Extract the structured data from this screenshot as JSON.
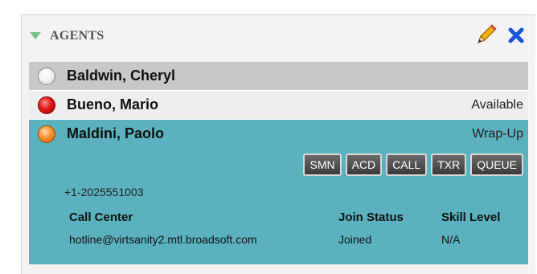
{
  "panel": {
    "title": "AGENTS",
    "icons": {
      "collapse": "triangle-down-icon",
      "edit": "pencil-icon",
      "close": "close-x-icon"
    }
  },
  "agents": [
    {
      "name": "Baldwin, Cheryl",
      "status": "",
      "indicator": "unavailable-white"
    },
    {
      "name": "Bueno, Mario",
      "status": "Available",
      "indicator": "busy-red"
    },
    {
      "name": "Maldini, Paolo",
      "status": "Wrap-Up",
      "indicator": "wrap-up-orange"
    }
  ],
  "selected": {
    "buttons": [
      "SMN",
      "ACD",
      "CALL",
      "TXR",
      "QUEUE"
    ],
    "phone": "+1-2025551003",
    "table": {
      "headers": [
        "Call Center",
        "Join Status",
        "Skill Level"
      ],
      "rows": [
        [
          "hotline@virtsanity2.mtl.broadsoft.com",
          "Joined",
          "N/A"
        ]
      ]
    }
  },
  "colors": {
    "selected_row": "#5bb1be",
    "header_row": "#c8c8c8",
    "accent": "#1a55d6"
  }
}
